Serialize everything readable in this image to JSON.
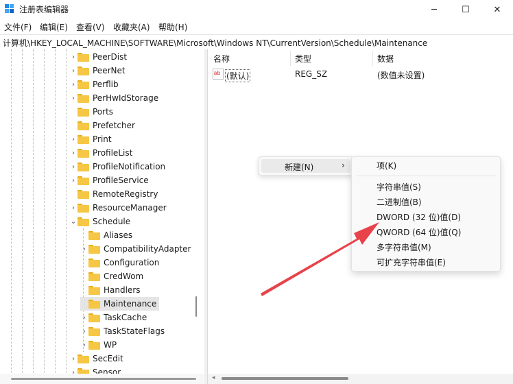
{
  "window": {
    "title": "注册表编辑器",
    "minimize": "─",
    "maximize": "☐",
    "close": "✕"
  },
  "menubar": [
    "文件(F)",
    "编辑(E)",
    "查看(V)",
    "收藏夹(A)",
    "帮助(H)"
  ],
  "address": "计算机\\HKEY_LOCAL_MACHINE\\SOFTWARE\\Microsoft\\Windows NT\\CurrentVersion\\Schedule\\Maintenance",
  "tree": {
    "items": [
      {
        "label": "PeerDist",
        "expandable": true,
        "level": 0
      },
      {
        "label": "PeerNet",
        "expandable": true,
        "level": 0
      },
      {
        "label": "Perflib",
        "expandable": true,
        "level": 0
      },
      {
        "label": "PerHwIdStorage",
        "expandable": true,
        "level": 0
      },
      {
        "label": "Ports",
        "expandable": false,
        "level": 0
      },
      {
        "label": "Prefetcher",
        "expandable": false,
        "level": 0
      },
      {
        "label": "Print",
        "expandable": true,
        "level": 0
      },
      {
        "label": "ProfileList",
        "expandable": true,
        "level": 0
      },
      {
        "label": "ProfileNotification",
        "expandable": true,
        "level": 0
      },
      {
        "label": "ProfileService",
        "expandable": true,
        "level": 0
      },
      {
        "label": "RemoteRegistry",
        "expandable": false,
        "level": 0
      },
      {
        "label": "ResourceManager",
        "expandable": true,
        "level": 0
      },
      {
        "label": "Schedule",
        "expandable": true,
        "expanded": true,
        "level": 0
      },
      {
        "label": "Aliases",
        "expandable": false,
        "level": 1
      },
      {
        "label": "CompatibilityAdapter",
        "expandable": true,
        "level": 1
      },
      {
        "label": "Configuration",
        "expandable": false,
        "level": 1
      },
      {
        "label": "CredWom",
        "expandable": false,
        "level": 1
      },
      {
        "label": "Handlers",
        "expandable": false,
        "level": 1
      },
      {
        "label": "Maintenance",
        "expandable": false,
        "level": 1,
        "selected": true
      },
      {
        "label": "TaskCache",
        "expandable": true,
        "level": 1
      },
      {
        "label": "TaskStateFlags",
        "expandable": true,
        "level": 1
      },
      {
        "label": "WP",
        "expandable": true,
        "level": 1
      },
      {
        "label": "SecEdit",
        "expandable": true,
        "level": 0
      },
      {
        "label": "Sensor",
        "expandable": true,
        "level": 0
      }
    ]
  },
  "list": {
    "columns": [
      "名称",
      "类型",
      "数据"
    ],
    "rows": [
      {
        "name": "(默认)",
        "type": "REG_SZ",
        "data": "(数值未设置)"
      }
    ]
  },
  "context_menu": {
    "new_item": "新建(N)",
    "submenu": [
      "项(K)",
      "字符串值(S)",
      "二进制值(B)",
      "DWORD (32 位)值(D)",
      "QWORD (64 位)值(Q)",
      "多字符串值(M)",
      "可扩充字符串值(E)"
    ]
  },
  "colors": {
    "folder": "#f6c744",
    "arrow": "#e8424a",
    "accent": "#0067c0"
  }
}
